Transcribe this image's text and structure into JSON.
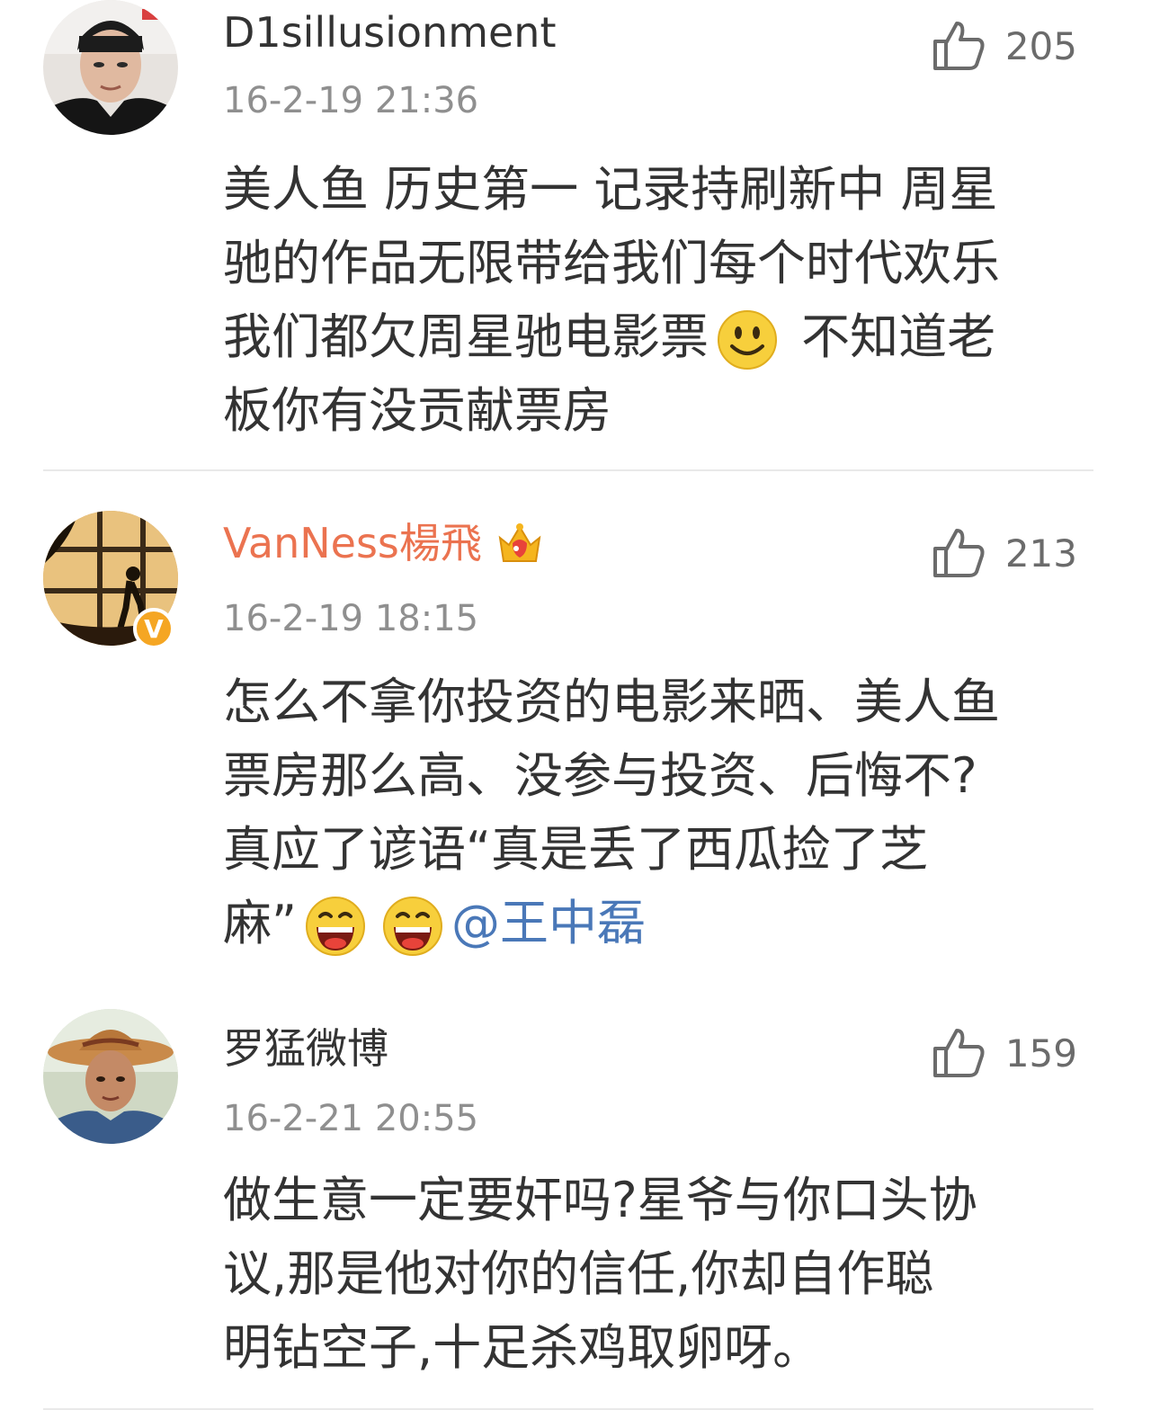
{
  "comments": [
    {
      "username": "D1sillusionment",
      "time": "16-2-19 21:36",
      "likes": "205",
      "lines": [
        {
          "text": "美人鱼 历史第一 记录持刷新中 周星"
        },
        {
          "text": "驰的作品无限带给我们每个时代欢乐"
        },
        {
          "pre": "我们都欠周星驰电影票",
          "post": " 不知道老"
        },
        {
          "text": "板你有没贡献票房"
        }
      ]
    },
    {
      "username": "VanNess楊飛",
      "verified_badge": "V",
      "time": "16-2-19 18:15",
      "likes": "213",
      "lines": [
        {
          "text": "怎么不拿你投资的电影来晒、美人鱼"
        },
        {
          "text": "票房那么高、没参与投资、后悔不?"
        },
        {
          "text": "真应了谚语“真是丢了西瓜捡了芝"
        },
        {
          "pre": "麻”",
          "mention": "@王中磊"
        }
      ]
    },
    {
      "username": "罗猛微博",
      "time": "16-2-21 20:55",
      "likes": "159",
      "lines": [
        {
          "text": "做生意一定要奸吗?星爷与你口头协"
        },
        {
          "text": "议,那是他对你的信任,你却自作聪"
        },
        {
          "text": "明钻空子,十足杀鸡取卵呀。"
        }
      ]
    }
  ],
  "colors": {
    "vip_name": "#eb7350",
    "mention": "#4a78b8",
    "time": "#8f8f8f",
    "verified": "#f5a623"
  },
  "icons": [
    "thumbs-up-icon",
    "smile-emoji-icon",
    "laugh-emoji-icon",
    "crown-vip-icon",
    "verified-v-icon"
  ]
}
